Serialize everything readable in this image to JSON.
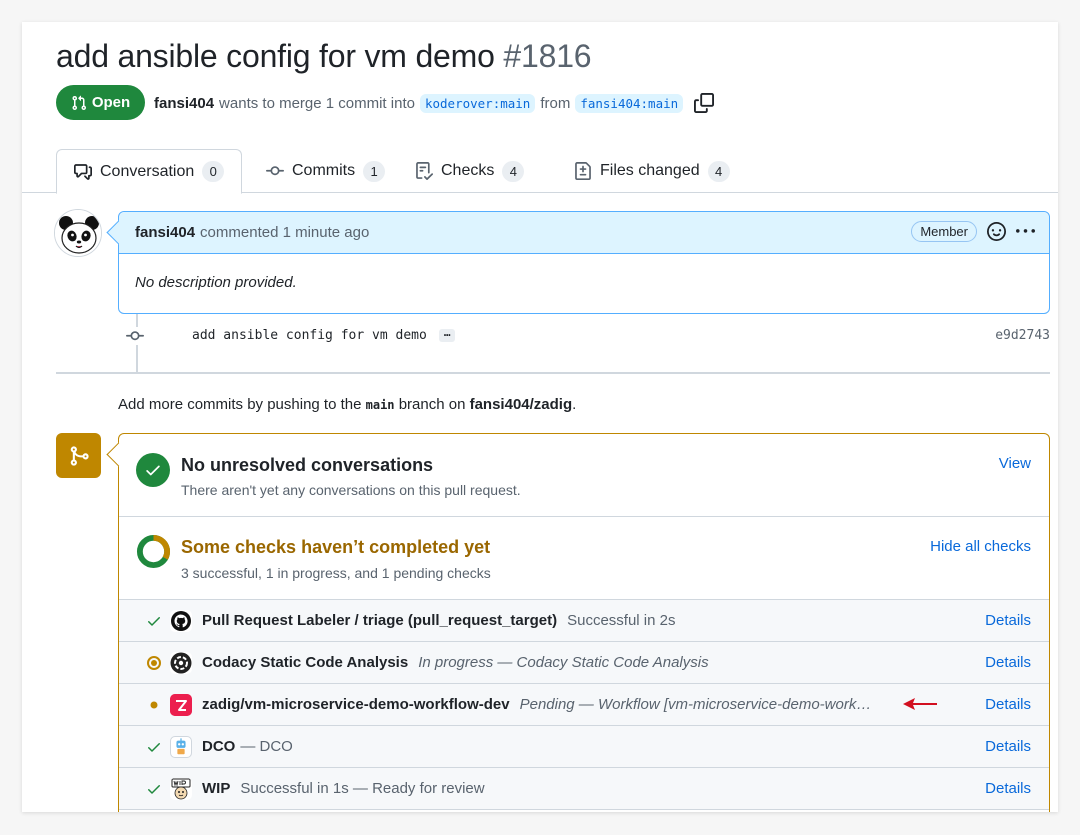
{
  "pr": {
    "title": "add ansible config for vm demo",
    "number": "#1816",
    "state_label": "Open",
    "author": "fansi404",
    "merge_text": "wants to merge 1 commit into",
    "base_branch": "koderover:main",
    "from_text": "from",
    "head_branch": "fansi404:main"
  },
  "tabs": [
    {
      "label": "Conversation",
      "count": "0",
      "icon": "comment-discussion-icon"
    },
    {
      "label": "Commits",
      "count": "1",
      "icon": "git-commit-icon"
    },
    {
      "label": "Checks",
      "count": "4",
      "icon": "checklist-icon"
    },
    {
      "label": "Files changed",
      "count": "4",
      "icon": "file-diff-icon"
    }
  ],
  "comment": {
    "author": "fansi404",
    "meta": "commented 1 minute ago",
    "role_badge": "Member",
    "body": "No description provided."
  },
  "commit": {
    "message": "add ansible config for vm demo",
    "ellipsis": "…",
    "sha": "e9d2743"
  },
  "push_note": {
    "prefix": "Add more commits by pushing to the",
    "branch": "main",
    "middle": "branch on",
    "repo": "fansi404/zadig",
    "suffix": "."
  },
  "merge_box": {
    "conversations_title": "No unresolved conversations",
    "conversations_sub": "There aren't yet any conversations on this pull request.",
    "conversations_link": "View",
    "checks_title": "Some checks haven’t completed yet",
    "checks_sub": "3 successful, 1 in progress, and 1 pending checks",
    "checks_link": "Hide all checks",
    "colors": {
      "success": "#1f883d",
      "pending": "#bf8700",
      "pending_text": "#9a6700",
      "link": "#0969da"
    }
  },
  "checks": [
    {
      "status": "success",
      "name": "Pull Request Labeler / triage (pull_request_target)",
      "desc": "Successful in 2s",
      "italic": false,
      "details": "Details",
      "app_icon": "github-icon"
    },
    {
      "status": "in-progress",
      "name": "Codacy Static Code Analysis",
      "desc": "In progress — Codacy Static Code Analysis",
      "italic": true,
      "details": "Details",
      "app_icon": "codacy-icon"
    },
    {
      "status": "pending",
      "name": "zadig/vm-microservice-demo-workflow-dev",
      "desc": "Pending — Workflow [vm-microservice-demo-work…",
      "italic": true,
      "details": "Details",
      "app_icon": "zadig-icon"
    },
    {
      "status": "success",
      "name": "DCO",
      "desc": "— DCO",
      "italic": false,
      "details": "Details",
      "app_icon": "dco-robot-icon"
    },
    {
      "status": "success",
      "name": "WIP",
      "desc": "Successful in 1s — Ready for review",
      "italic": false,
      "details": "Details",
      "app_icon": "wip-icon"
    }
  ]
}
